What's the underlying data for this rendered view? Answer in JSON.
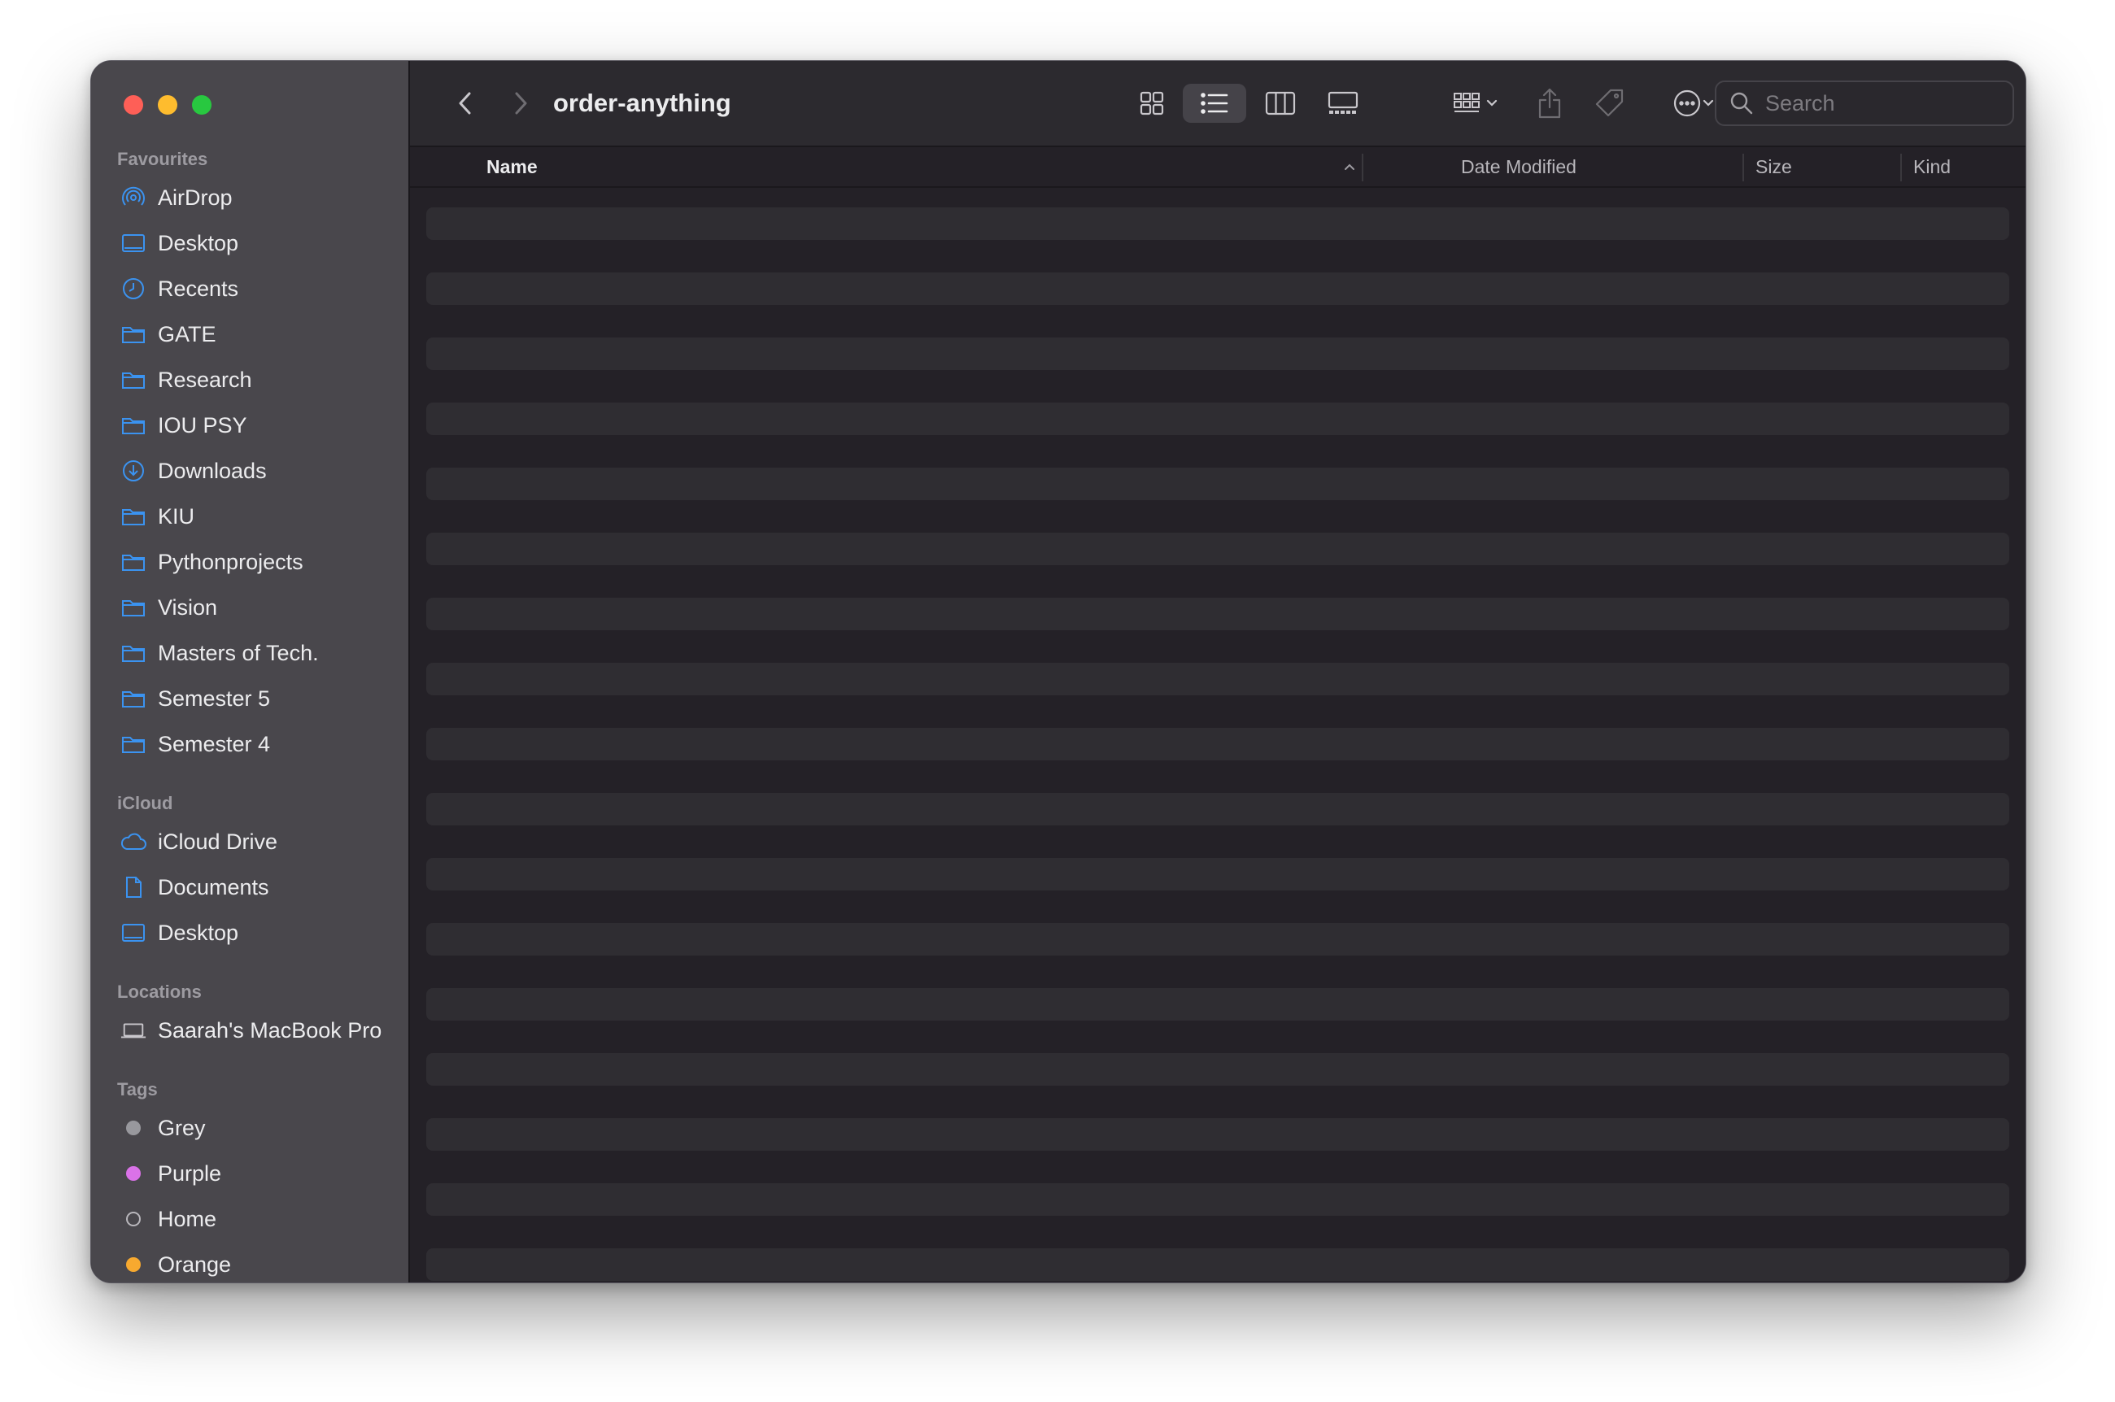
{
  "window": {
    "title": "order-anything"
  },
  "sidebar": {
    "favourites_title": "Favourites",
    "favourites": [
      {
        "label": "AirDrop",
        "icon": "airdrop-icon"
      },
      {
        "label": "Desktop",
        "icon": "desktop-icon"
      },
      {
        "label": "Recents",
        "icon": "clock-icon"
      },
      {
        "label": "GATE",
        "icon": "folder-icon"
      },
      {
        "label": "Research",
        "icon": "folder-icon"
      },
      {
        "label": "IOU PSY",
        "icon": "folder-icon"
      },
      {
        "label": "Downloads",
        "icon": "download-icon"
      },
      {
        "label": "KIU",
        "icon": "folder-icon"
      },
      {
        "label": "Pythonprojects",
        "icon": "folder-icon"
      },
      {
        "label": "Vision",
        "icon": "folder-icon"
      },
      {
        "label": "Masters of Tech.",
        "icon": "folder-icon"
      },
      {
        "label": "Semester 5",
        "icon": "folder-icon"
      },
      {
        "label": "Semester 4",
        "icon": "folder-icon"
      }
    ],
    "icloud_title": "iCloud",
    "icloud": [
      {
        "label": "iCloud Drive",
        "icon": "cloud-icon"
      },
      {
        "label": "Documents",
        "icon": "document-icon"
      },
      {
        "label": "Desktop",
        "icon": "desktop-icon"
      }
    ],
    "locations_title": "Locations",
    "locations": [
      {
        "label": "Saarah's MacBook Pro",
        "icon": "laptop-icon"
      }
    ],
    "tags_title": "Tags",
    "tags": [
      {
        "label": "Grey",
        "color": "#98989d"
      },
      {
        "label": "Purple",
        "color": "#da72e8"
      },
      {
        "label": "Home",
        "color": ""
      },
      {
        "label": "Orange",
        "color": "#f7a92f"
      }
    ]
  },
  "toolbar": {
    "view_modes": [
      "icon-view",
      "list-view",
      "column-view",
      "gallery-view"
    ],
    "active_view": "list-view",
    "search_placeholder": "Search"
  },
  "columns": {
    "name": "Name",
    "date_modified": "Date Modified",
    "size": "Size",
    "kind": "Kind",
    "sort_column": "Name",
    "sort_direction": "ascending"
  },
  "files": [],
  "colors": {
    "accent": "#3b93f0",
    "sidebar_bg": "#49474c",
    "content_bg": "#242127"
  }
}
